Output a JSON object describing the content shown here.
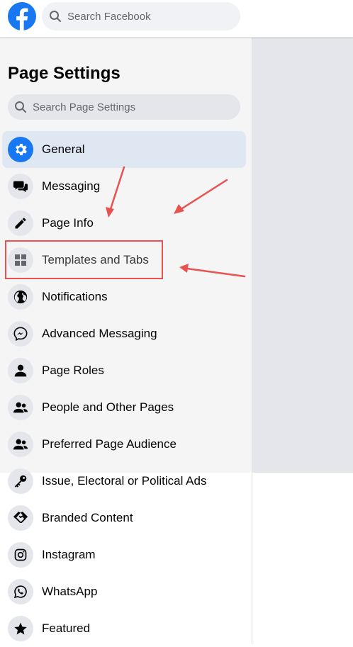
{
  "topbar": {
    "logo_icon": "facebook-logo-icon",
    "search_placeholder": "Search Facebook",
    "brand_color": "#1877f2"
  },
  "sidebar": {
    "title": "Page Settings",
    "search_placeholder": "Search Page Settings",
    "items": [
      {
        "label": "General",
        "icon": "gear-icon",
        "active": true
      },
      {
        "label": "Messaging",
        "icon": "chat-bubbles-icon"
      },
      {
        "label": "Page Info",
        "icon": "pencil-icon"
      },
      {
        "label": "Templates and Tabs",
        "icon": "grid-icon",
        "highlighted": true
      },
      {
        "label": "Notifications",
        "icon": "globe-icon"
      },
      {
        "label": "Advanced Messaging",
        "icon": "messenger-icon"
      },
      {
        "label": "Page Roles",
        "icon": "person-icon"
      },
      {
        "label": "People and Other Pages",
        "icon": "people-icon"
      },
      {
        "label": "Preferred Page Audience",
        "icon": "people-icon"
      },
      {
        "label": "Issue, Electoral or Political Ads",
        "icon": "key-icon"
      },
      {
        "label": "Branded Content",
        "icon": "handshake-icon"
      },
      {
        "label": "Instagram",
        "icon": "instagram-icon"
      },
      {
        "label": "WhatsApp",
        "icon": "whatsapp-icon"
      },
      {
        "label": "Featured",
        "icon": "star-icon"
      }
    ]
  },
  "colors": {
    "active_item_bg": "#dfe8f2",
    "annotation_red": "#e8524f",
    "sidebar_bg": "#f5f5f5",
    "overlay_panel": "#e4e6eb"
  }
}
